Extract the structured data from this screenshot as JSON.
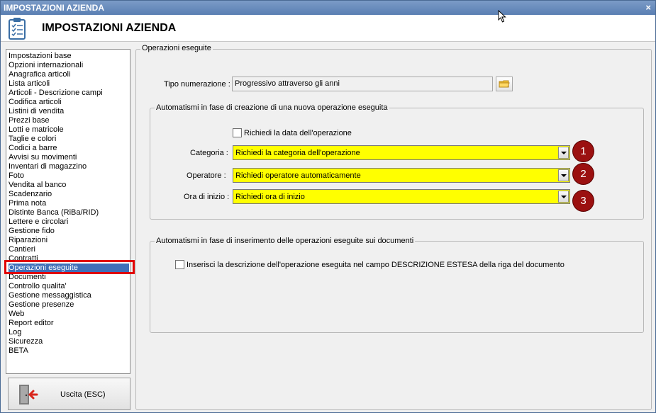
{
  "window": {
    "title": "IMPOSTAZIONI AZIENDA",
    "close_glyph": "×"
  },
  "header": {
    "title": "IMPOSTAZIONI AZIENDA",
    "icon": "clipboard-checklist-icon"
  },
  "sidebar": {
    "items": [
      "Impostazioni base",
      "Opzioni internazionali",
      "Anagrafica articoli",
      "Lista articoli",
      "Articoli - Descrizione campi",
      "Codifica articoli",
      "Listini di vendita",
      "Prezzi base",
      "Lotti e matricole",
      "Taglie e colori",
      "Codici a barre",
      "Avvisi su movimenti",
      "Inventari di magazzino",
      "Foto",
      "Vendita al banco",
      "Scadenzario",
      "Prima nota",
      "Distinte Banca (RiBa/RID)",
      "Lettere e circolari",
      "Gestione fido",
      "Riparazioni",
      "Cantieri",
      "Contratti",
      "Operazioni eseguite",
      "Documenti",
      "Controllo qualita'",
      "Gestione messaggistica",
      "Gestione presenze",
      "Web",
      "Report editor",
      "Log",
      "Sicurezza",
      "BETA"
    ],
    "selected": "Operazioni eseguite",
    "selection_color": "#3f6fb8"
  },
  "exit_button": {
    "label": "Uscita (ESC)",
    "icon": "exit-door-icon"
  },
  "main": {
    "group_title": "Operazioni eseguite",
    "numbering": {
      "label": "Tipo numerazione :",
      "value": "Progressivo attraverso gli anni",
      "button_icon": "folder-icon"
    },
    "creation_group": {
      "title": "Automatismi in fase di creazione di una nuova operazione eseguita",
      "ask_date": {
        "label": "Richiedi la data dell'operazione",
        "checked": false
      },
      "category": {
        "label": "Categoria :",
        "value": "Richiedi la categoria dell'operazione",
        "badge": "1"
      },
      "operator": {
        "label": "Operatore :",
        "value": "Richiedi operatore automaticamente",
        "badge": "2"
      },
      "start_time": {
        "label": "Ora di inizio :",
        "value": "Richiedi ora di inizio",
        "badge": "3"
      }
    },
    "insert_group": {
      "title": "Automatismi in fase di inserimento delle operazioni eseguite sui documenti",
      "insert_desc": {
        "label": "Inserisci la descrizione dell'operazione eseguita nel campo DESCRIZIONE ESTESA della riga del documento",
        "checked": false
      }
    }
  },
  "colors": {
    "highlight": "#ffff00",
    "badge": "#9b1010",
    "selection_outline": "#e00000",
    "titlebar": "#5a7fb3"
  }
}
